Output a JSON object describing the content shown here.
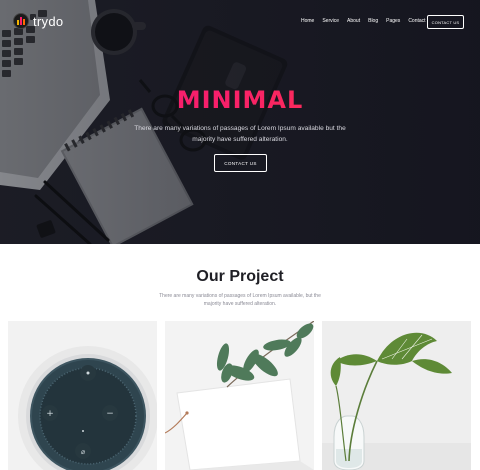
{
  "brand": {
    "name": "trydo"
  },
  "nav": {
    "items": [
      "Home",
      "Service",
      "About",
      "Blog",
      "Pages",
      "Contact"
    ],
    "cta": "CONTACT US"
  },
  "hero": {
    "title": "MINIMAL",
    "description": "There are many variations of passages of Lorem Ipsum available but the majority have suffered alteration.",
    "cta": "CONTACT US"
  },
  "projects": {
    "title": "Our Project",
    "description": "There are many variations of passages of Lorem Ipsum available, but the majority have suffered alteration.",
    "items": [
      "smart-speaker-photo",
      "eucalyptus-card-photo",
      "plant-in-vase-photo"
    ]
  },
  "colors": {
    "hero_bg": "#1d1e27",
    "accent_start": "#f81f6b",
    "accent_end": "#ff3f3f",
    "heading": "#1f1f25",
    "body_text": "#8a8a95"
  }
}
